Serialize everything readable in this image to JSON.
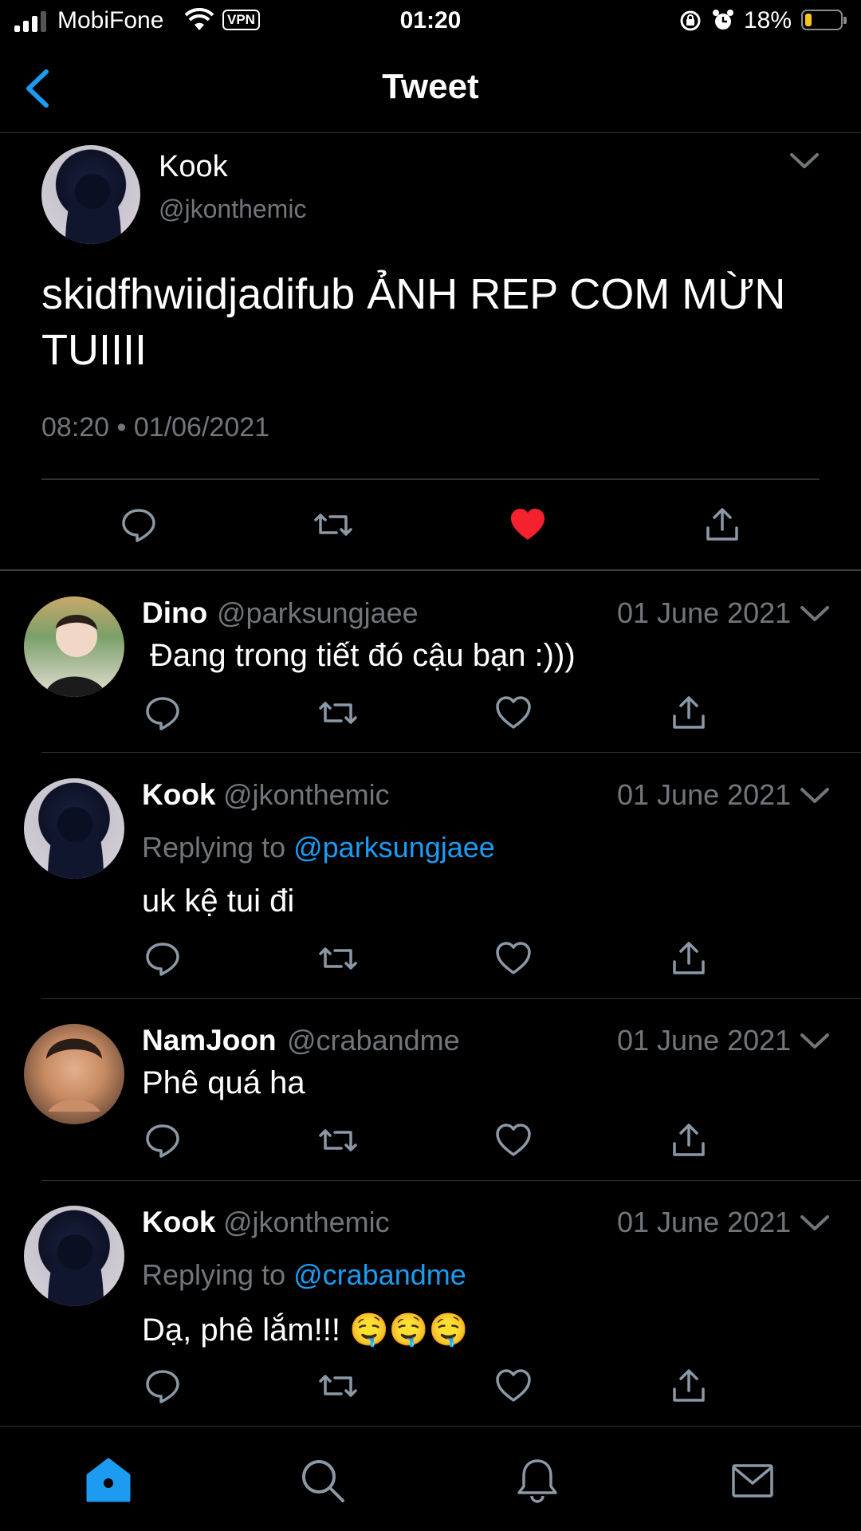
{
  "status_bar": {
    "carrier": "MobiFone",
    "vpn": "VPN",
    "time": "01:20",
    "battery": "18%"
  },
  "header": {
    "title": "Tweet"
  },
  "main_tweet": {
    "name": "Kook",
    "handle": "@jkonthemic",
    "text": "skidfhwiidjadifub ẢNH REP COM MỪN TUIIII",
    "timestamp": "08:20 • 01/06/2021",
    "liked": true
  },
  "replies": [
    {
      "name": "Dino",
      "handle": "@parksungjaee",
      "date": "01 June 2021",
      "replying_prefix": "",
      "replying_to": "",
      "text": "Đang trong tiết đó cậu bạn :)))"
    },
    {
      "name": "Kook",
      "handle": "@jkonthemic",
      "date": "01 June 2021",
      "replying_prefix": "Replying to ",
      "replying_to": "@parksungjaee",
      "text": "uk kệ tui đi"
    },
    {
      "name": "NamJoon",
      "handle": "@crabandme",
      "date": "01 June 2021",
      "replying_prefix": "",
      "replying_to": "",
      "text": "Phê quá ha"
    },
    {
      "name": "Kook",
      "handle": "@jkonthemic",
      "date": "01 June 2021",
      "replying_prefix": "Replying to ",
      "replying_to": "@crabandme",
      "text": "Dạ, phê lắm!!! 🤤🤤🤤"
    }
  ],
  "colors": {
    "accent": "#1d9bf0",
    "like": "#f4212e",
    "muted": "#71767b"
  },
  "icons": [
    "back-icon",
    "caret-down-icon",
    "reply-icon",
    "retweet-icon",
    "heart-icon",
    "share-icon",
    "home-icon",
    "search-icon",
    "bell-icon",
    "mail-icon"
  ]
}
